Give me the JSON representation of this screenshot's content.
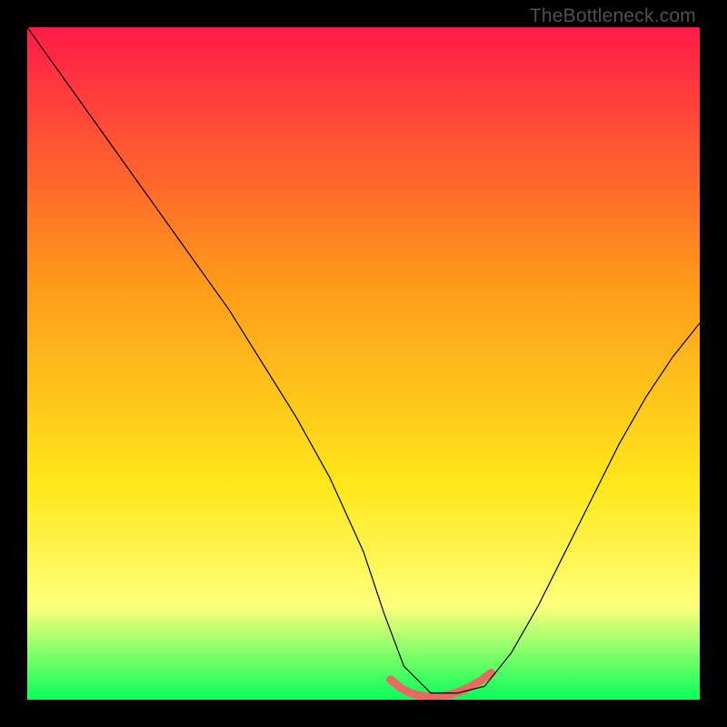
{
  "watermark": {
    "text": "TheBottleneck.com"
  },
  "chart_data": {
    "type": "line",
    "title": "",
    "xlabel": "",
    "ylabel": "",
    "xlim": [
      0,
      100
    ],
    "ylim": [
      0,
      100
    ],
    "grid": false,
    "legend": false,
    "background_gradient_colors": [
      "#ff1a4a",
      "#ff9a1a",
      "#ffe71a",
      "#ffff7a",
      "#06ff5a"
    ],
    "background_gradient_stops_pct": [
      0,
      38,
      68,
      86,
      100
    ],
    "series": [
      {
        "name": "bottleneck-curve",
        "color": "#000000",
        "stroke_width": 1.2,
        "x": [
          0,
          5,
          10,
          15,
          20,
          25,
          30,
          35,
          40,
          45,
          50,
          53,
          56,
          60,
          64,
          68,
          72,
          76,
          80,
          84,
          88,
          92,
          96,
          100
        ],
        "y": [
          100,
          93,
          86,
          79,
          72,
          65,
          58,
          50,
          42,
          33,
          22,
          13,
          5,
          1,
          1,
          2,
          7,
          14,
          22,
          30,
          38,
          45,
          51,
          56
        ]
      },
      {
        "name": "sweet-spot-band",
        "color": "#e96a63",
        "stroke_width": 9,
        "stroke_linecap": "round",
        "x": [
          54,
          55.5,
          57,
          58.5,
          60,
          61.5,
          63,
          64.5,
          66,
          67.5,
          69
        ],
        "y": [
          3.0,
          1.8,
          1.0,
          0.6,
          0.5,
          0.55,
          0.8,
          1.3,
          2.0,
          2.9,
          4.0
        ]
      }
    ]
  }
}
